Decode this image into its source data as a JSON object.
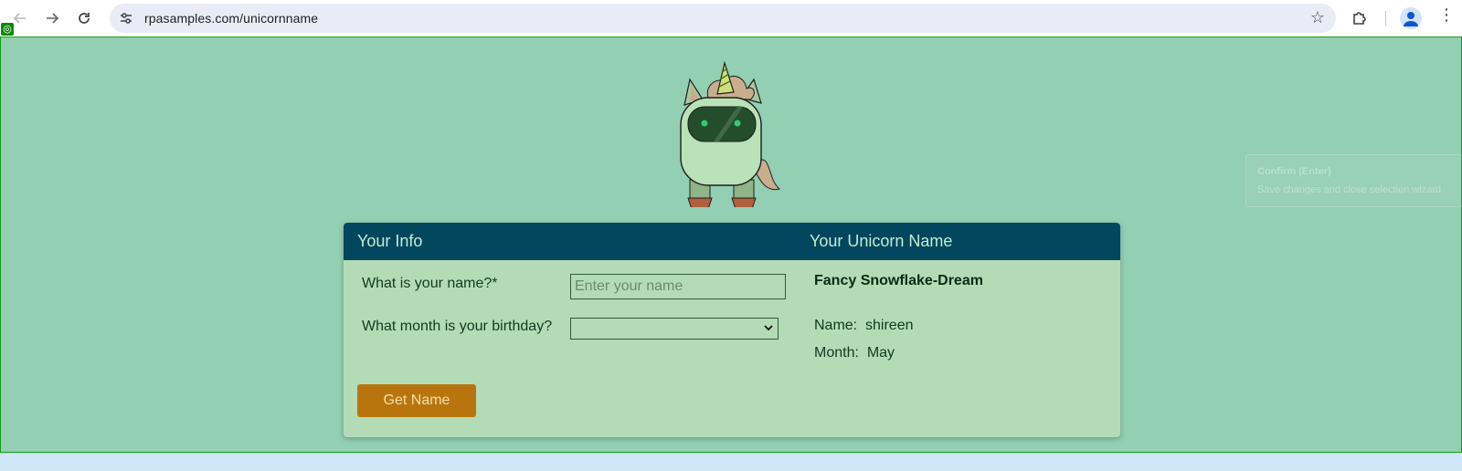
{
  "browser": {
    "url": "rpasamples.com/unicornname"
  },
  "form": {
    "header_left": "Your Info",
    "name_label": "What is your name?*",
    "name_placeholder": "Enter your name",
    "name_value": "",
    "month_label": "What month is your birthday?",
    "month_selected": "",
    "button_label": "Get Name"
  },
  "result": {
    "header": "Your Unicorn Name",
    "unicorn_name": "Fancy Snowflake-Dream",
    "name_label": "Name:",
    "name_value": "shireen",
    "month_label": "Month:",
    "month_value": "May"
  },
  "tooltip": {
    "title": "Confirm (Enter)",
    "description": "Save changes and close selection wizard."
  },
  "icons": {
    "back": "arrow-left-icon",
    "forward": "arrow-right-icon",
    "reload": "reload-icon",
    "site_info": "site-settings-icon",
    "bookmark": "star-icon",
    "extensions": "puzzle-icon",
    "profile": "person-icon",
    "menu": "more-vert-icon",
    "select_arrow": "chevron-down-icon",
    "recorder": "target-icon"
  },
  "colors": {
    "page_bg": "#93cfb2",
    "card_bg": "#b3dcb6",
    "header_bg": "#02475e",
    "header_text": "#c3ecd0",
    "button_bg": "#b9750d",
    "button_text": "#f6deaa"
  }
}
